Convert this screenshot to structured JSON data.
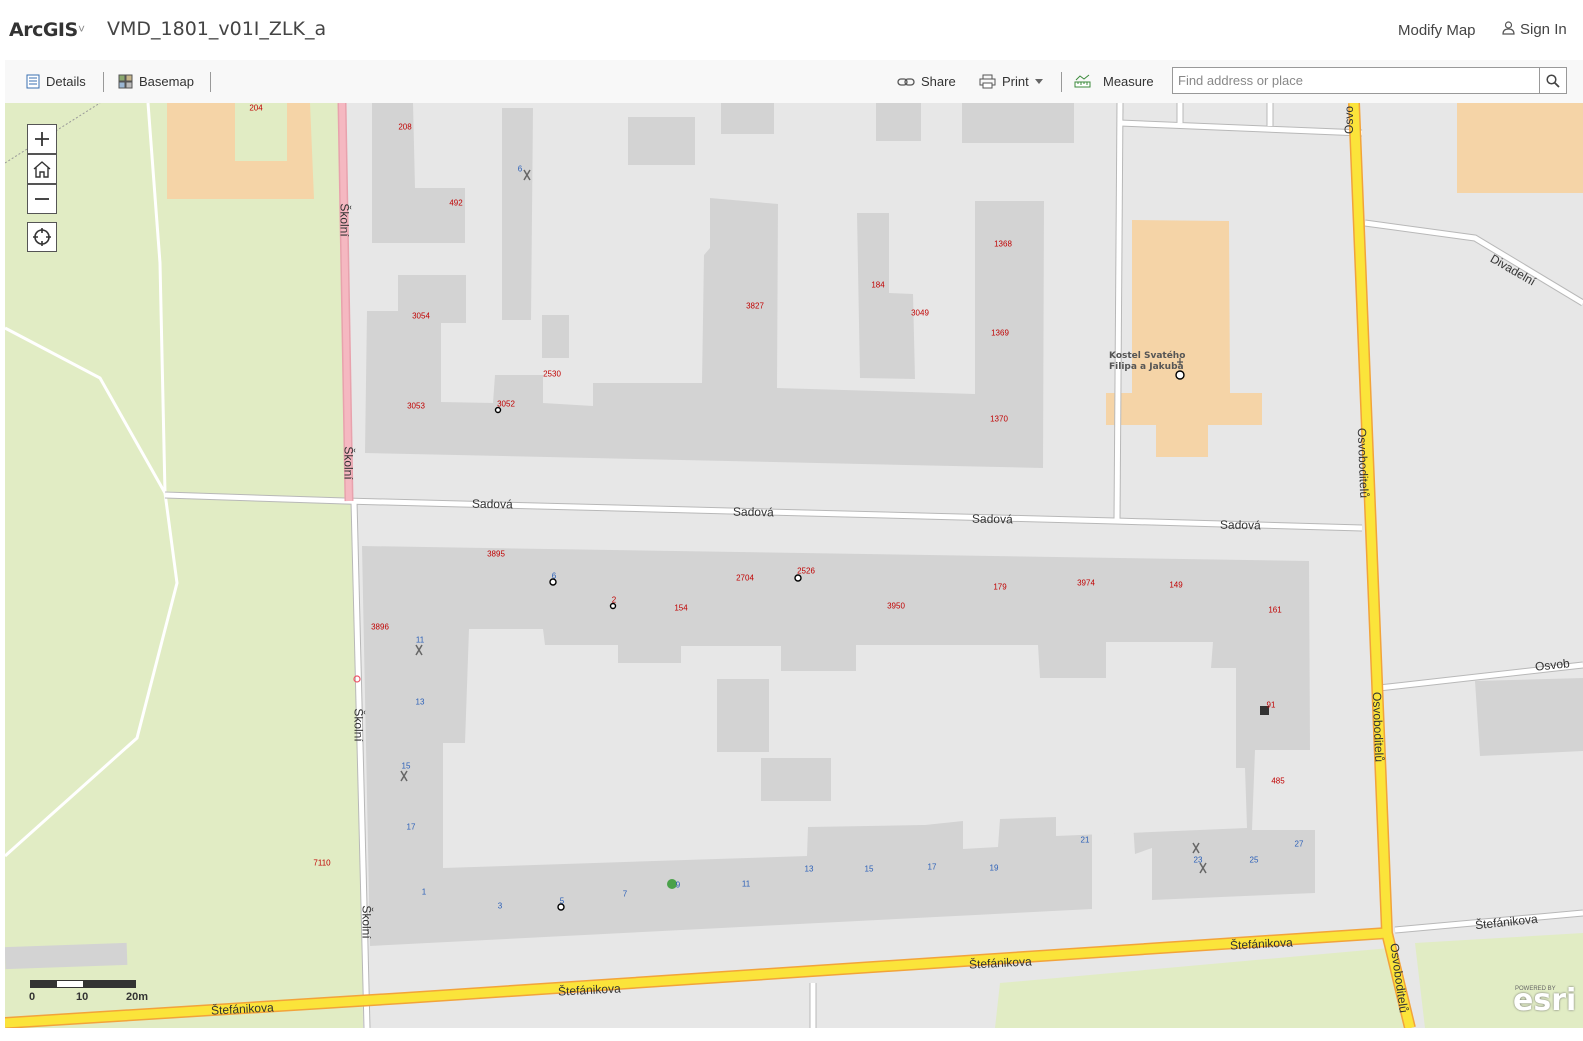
{
  "header": {
    "brand": "ArcGIS",
    "brand_caret": "˅",
    "map_title": "VMD_1801_v01I_ZLK_a",
    "modify_map": "Modify Map",
    "sign_in": "Sign In"
  },
  "toolbar": {
    "details": "Details",
    "basemap": "Basemap",
    "share": "Share",
    "print": "Print",
    "measure": "Measure",
    "search_placeholder": "Find address or place"
  },
  "icons": {
    "zoom_in": "plus-icon",
    "home": "home-icon",
    "zoom_out": "minus-icon",
    "locate": "locate-icon",
    "search": "search-icon",
    "user": "user-icon"
  },
  "colors": {
    "road_major": "#fbe43a",
    "road_edge": "#f2a33a",
    "building": "#d3d3d3",
    "park": "#e1ecc4",
    "poi_area": "#f5d4a7",
    "background": "#e7e7e7"
  },
  "streets": {
    "sadova": "Sadová",
    "skolni": "Školní",
    "stefanikova": "Štefánikova",
    "osvoboditelu": "Osvoboditelů",
    "osvo_short": "Osvo",
    "osvob": "Osvob",
    "divadelni": "Divadelní"
  },
  "poi": {
    "church_line1": "Kostel Svatého",
    "church_line2": "Filipa a Jakuba"
  },
  "building_numbers": [
    "204",
    "208",
    "492",
    "3054",
    "3053",
    "3052",
    "2530",
    "3827",
    "184",
    "3049",
    "1368",
    "1369",
    "1370",
    "3895",
    "2704",
    "2526",
    "3950",
    "179",
    "3974",
    "149",
    "161",
    "154",
    "2",
    "6",
    "3896",
    "485",
    "91",
    "7110"
  ],
  "house_numbers": [
    "6",
    "11",
    "13",
    "15",
    "17",
    "1",
    "3",
    "5",
    "7",
    "9",
    "11",
    "13",
    "15",
    "17",
    "19",
    "21",
    "23",
    "25",
    "27"
  ],
  "scale": {
    "labels": [
      "0",
      "10",
      "20m"
    ]
  },
  "attribution": {
    "powered": "POWERED BY",
    "esri": "esri"
  }
}
